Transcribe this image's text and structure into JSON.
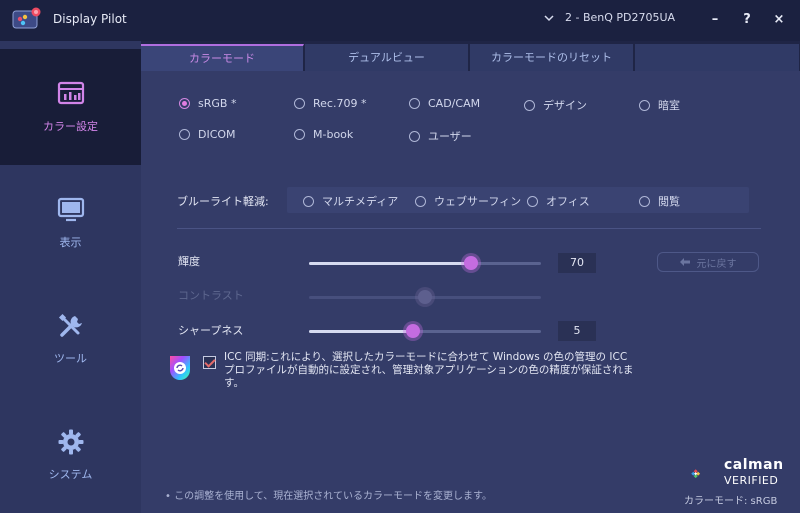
{
  "app": {
    "title": "Display Pilot"
  },
  "monitor": {
    "selected": "2 - BenQ PD2705UA"
  },
  "window_controls": {
    "minimize": "–",
    "help": "?",
    "close": "×"
  },
  "sidebar": {
    "items": [
      {
        "label": "カラー設定",
        "icon": "color-settings-icon",
        "active": true
      },
      {
        "label": "表示",
        "icon": "monitor-icon",
        "active": false
      },
      {
        "label": "ツール",
        "icon": "tools-icon",
        "active": false
      },
      {
        "label": "システム",
        "icon": "gear-icon",
        "active": false
      }
    ]
  },
  "tabs": [
    {
      "label": "カラーモード",
      "active": true
    },
    {
      "label": "デュアルビュー",
      "active": false
    },
    {
      "label": "カラーモードのリセット",
      "active": false
    }
  ],
  "color_modes": [
    {
      "label": "sRGB *",
      "checked": true
    },
    {
      "label": "Rec.709 *",
      "checked": false
    },
    {
      "label": "CAD/CAM",
      "checked": false
    },
    {
      "label": "デザイン",
      "checked": false
    },
    {
      "label": "暗室",
      "checked": false
    },
    {
      "label": "DICOM",
      "checked": false
    },
    {
      "label": "M-book",
      "checked": false
    },
    {
      "label": "ユーザー",
      "checked": false
    }
  ],
  "blue_light": {
    "label": "ブルーライト軽減:",
    "options": [
      "マルチメディア",
      "ウェブサーフィン",
      "オフィス",
      "閲覧"
    ]
  },
  "sliders": {
    "brightness": {
      "label": "輝度",
      "value": 70,
      "value_text": "70",
      "fraction": 0.7,
      "enabled": true
    },
    "contrast": {
      "label": "コントラスト",
      "value": 50,
      "fraction": 0.5,
      "enabled": false
    },
    "sharpness": {
      "label": "シャープネス",
      "value": 5,
      "value_text": "5",
      "fraction": 0.45,
      "enabled": true
    }
  },
  "reset_button": {
    "label": "元に戻す"
  },
  "icc_sync": {
    "checked": true,
    "text": "ICC 同期:これにより、選択したカラーモードに合わせて Windows の色の管理の ICC プロファイルが自動的に設定され、管理対象アプリケーションの色の精度が保証されます。"
  },
  "footer": {
    "note": "• この調整を使用して、現在選択されているカラーモードを変更します。",
    "calman_word": "calman",
    "calman_verified": "VERIFIED",
    "color_mode_status": "カラーモード: sRGB"
  },
  "colors": {
    "accent": "#c46ce0",
    "sidebar_active_text": "#d184e8",
    "sidebar_text": "#9fb7ee",
    "checkmark": "#e46a6a"
  }
}
